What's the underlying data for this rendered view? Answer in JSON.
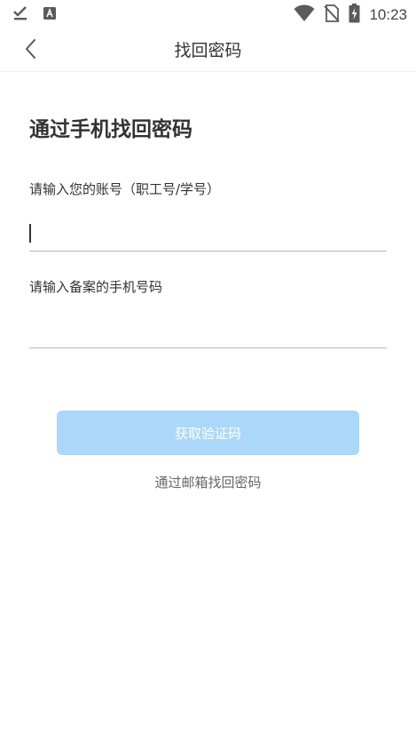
{
  "status_bar": {
    "time": "10:23",
    "icons": [
      "download-done-icon",
      "app-notification-icon",
      "wifi-icon",
      "no-sim-icon",
      "battery-charging-icon"
    ]
  },
  "app_bar": {
    "title": "找回密码",
    "back_icon": "chevron-left-icon"
  },
  "form": {
    "heading": "通过手机找回密码",
    "account_label": "请输入您的账号（职工号/学号）",
    "account_value": "",
    "phone_label": "请输入备案的手机号码",
    "phone_value": "",
    "submit_label": "获取验证码",
    "alt_link": "通过邮箱找回密码"
  },
  "colors": {
    "button_disabled": "#abd7f8",
    "text": "#333333"
  }
}
